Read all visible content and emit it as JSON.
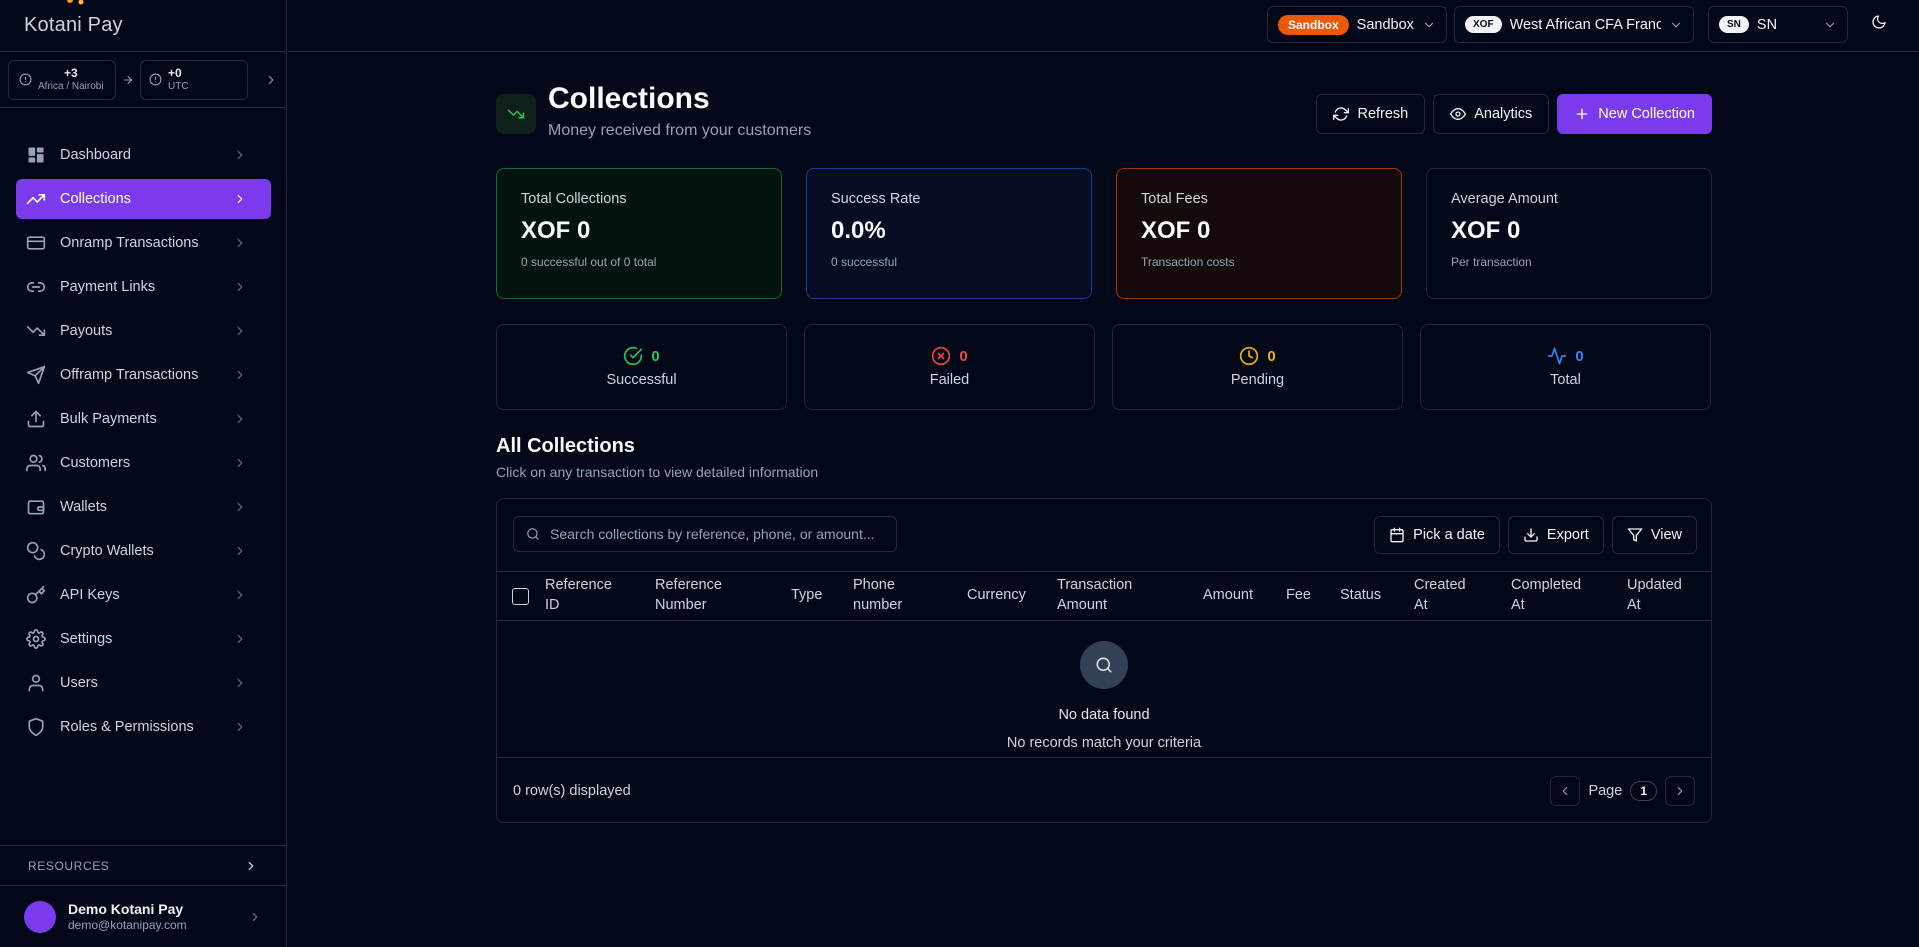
{
  "brand": {
    "name": "Kotani Pay"
  },
  "timezones": {
    "from": {
      "offset": "+3",
      "label": "Africa / Nairobi"
    },
    "to": {
      "offset": "+0",
      "label": "UTC"
    }
  },
  "nav": [
    {
      "label": "Dashboard",
      "icon": "dashboard-icon"
    },
    {
      "label": "Collections",
      "icon": "trending-up-icon",
      "active": true
    },
    {
      "label": "Onramp Transactions",
      "icon": "credit-card-icon"
    },
    {
      "label": "Payment Links",
      "icon": "link-icon"
    },
    {
      "label": "Payouts",
      "icon": "trending-down-icon"
    },
    {
      "label": "Offramp Transactions",
      "icon": "send-icon"
    },
    {
      "label": "Bulk Payments",
      "icon": "upload-icon"
    },
    {
      "label": "Customers",
      "icon": "users-icon"
    },
    {
      "label": "Wallets",
      "icon": "wallet-icon"
    },
    {
      "label": "Crypto Wallets",
      "icon": "coins-icon"
    },
    {
      "label": "API Keys",
      "icon": "key-icon"
    },
    {
      "label": "Settings",
      "icon": "gear-icon"
    },
    {
      "label": "Users",
      "icon": "user-icon"
    },
    {
      "label": "Roles & Permissions",
      "icon": "shield-icon"
    }
  ],
  "resources": {
    "label": "RESOURCES"
  },
  "user": {
    "name": "Demo Kotani Pay",
    "email": "demo@kotanipay.com"
  },
  "topbar": {
    "env_badge": "Sandbox",
    "env_value": "Sandbox",
    "currency_code": "XOF",
    "currency_name": "West African CFA Franc",
    "country_code": "SN",
    "country_value": "SN"
  },
  "page": {
    "title": "Collections",
    "subtitle": "Money received from your customers",
    "refresh_label": "Refresh",
    "analytics_label": "Analytics",
    "new_label": "New Collection"
  },
  "stats": [
    {
      "label": "Total Collections",
      "value": "XOF 0",
      "desc": "0 successful out of 0 total"
    },
    {
      "label": "Success Rate",
      "value": "0.0%",
      "desc": "0 successful"
    },
    {
      "label": "Total Fees",
      "value": "XOF 0",
      "desc": "Transaction costs"
    },
    {
      "label": "Average Amount",
      "value": "XOF 0",
      "desc": "Per transaction"
    }
  ],
  "status_counts": [
    {
      "count": "0",
      "label": "Successful"
    },
    {
      "count": "0",
      "label": "Failed"
    },
    {
      "count": "0",
      "label": "Pending"
    },
    {
      "count": "0",
      "label": "Total"
    }
  ],
  "table": {
    "title": "All Collections",
    "subtitle": "Click on any transaction to view detailed information",
    "search_placeholder": "Search collections by reference, phone, or amount...",
    "pick_date_label": "Pick a date",
    "export_label": "Export",
    "view_label": "View",
    "columns": [
      [
        "Reference",
        "ID"
      ],
      [
        "Reference",
        "Number"
      ],
      [
        "Type"
      ],
      [
        "Phone",
        "number"
      ],
      [
        "Currency"
      ],
      [
        "Transaction",
        "Amount"
      ],
      [
        "Amount"
      ],
      [
        "Fee"
      ],
      [
        "Status"
      ],
      [
        "Created",
        "At"
      ],
      [
        "Completed",
        "At"
      ],
      [
        "Updated",
        "At"
      ]
    ],
    "empty_title": "No data found",
    "empty_sub": "No records match your criteria",
    "rows_displayed": "0 row(s) displayed",
    "page_label": "Page",
    "page_number": "1"
  }
}
